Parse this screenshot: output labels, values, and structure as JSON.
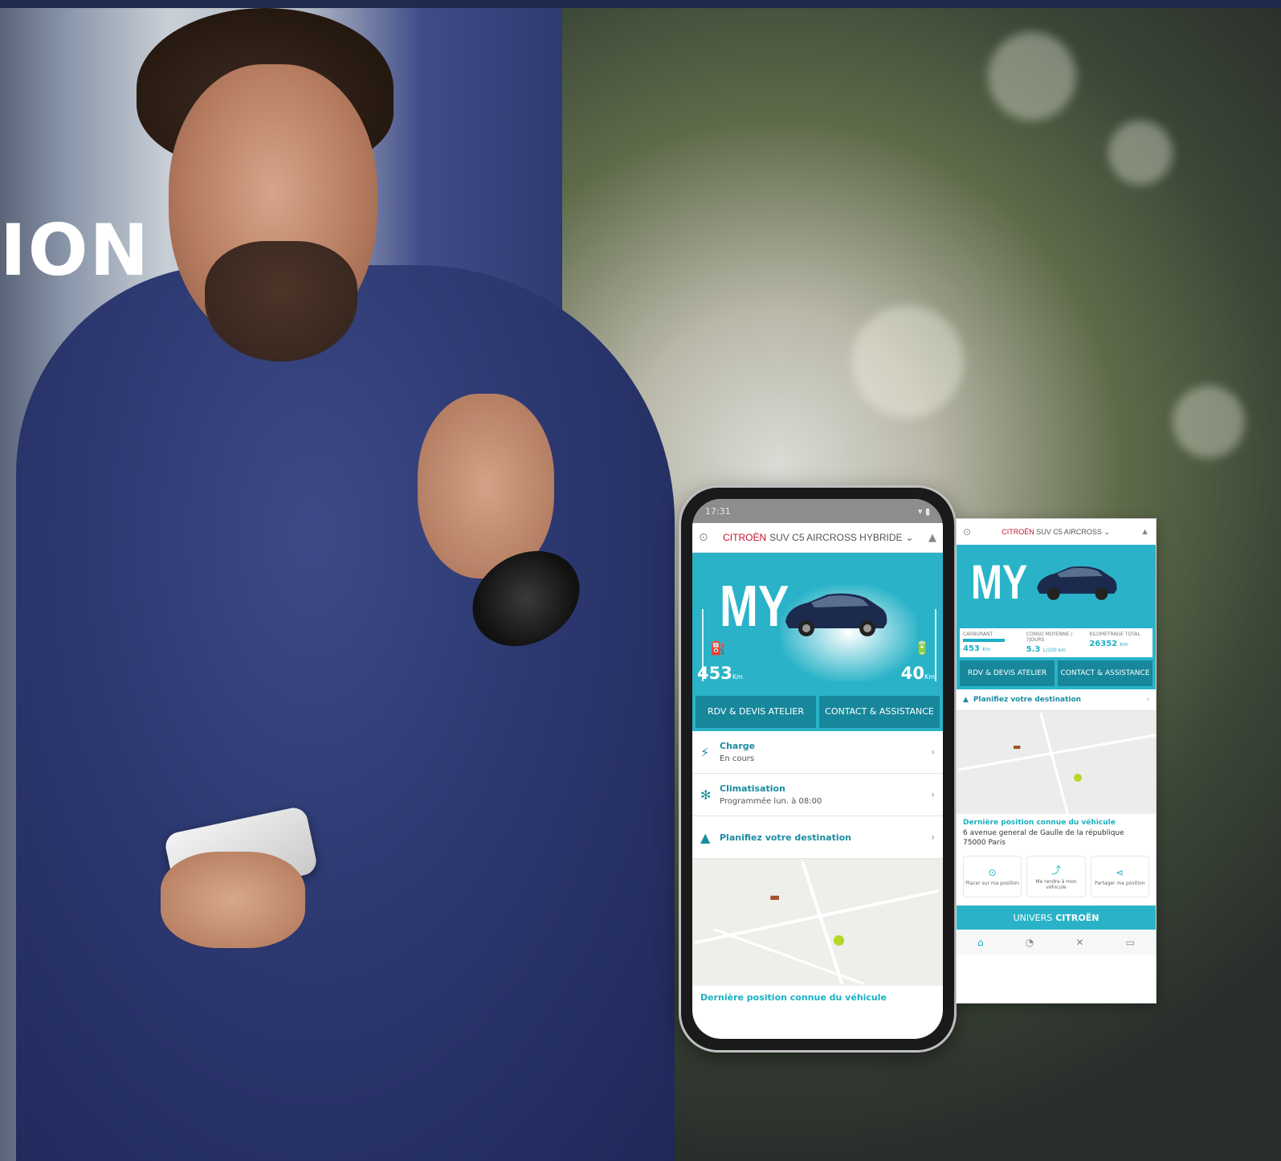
{
  "hero": {
    "headline": "ION"
  },
  "phone": {
    "status_time": "17:31",
    "brand": "CITROËN",
    "model": "SUV C5 AIRCROSS HYBRIDE",
    "hero_logo": "MY",
    "fuel_range": "453",
    "electric_range": "40",
    "range_unit": "Km",
    "actions": [
      "RDV & DEVIS ATELIER",
      "CONTACT & ASSISTANCE"
    ],
    "rows": [
      {
        "title": "Charge",
        "subtitle": "En cours",
        "icon": "charging-icon"
      },
      {
        "title": "Climatisation",
        "subtitle": "Programmée lun. à 08:00",
        "icon": "fan-icon"
      },
      {
        "title": "Planifiez votre destination",
        "subtitle": "",
        "icon": "navigation-arrow-icon"
      }
    ],
    "last_position_label": "Dernière position connue du véhicule"
  },
  "screen2": {
    "brand": "CITROËN",
    "model": "SUV C5 AIRCROSS",
    "hero_logo": "MY",
    "stats": {
      "fuel_label": "CARBURANT",
      "fuel_value": "453",
      "fuel_unit": "Km",
      "consumption_label": "CONSO MOYENNE / 7JOURS",
      "consumption_value": "5.3",
      "consumption_unit": "L/100 km",
      "mileage_label": "KILOMETRAGE TOTAL",
      "mileage_value": "26352",
      "mileage_unit": "Km"
    },
    "actions": [
      "RDV & DEVIS ATELIER",
      "CONTACT & ASSISTANCE"
    ],
    "destination_label": "Planifiez votre destination",
    "last_position_label": "Dernière position connue du véhicule",
    "address_line1": "6 avenue general de Gaulle de la république",
    "address_line2": "75000 Paris",
    "quick_actions": [
      "Placer sur ma position",
      "Me rendre à mon véhicule",
      "Partager ma position"
    ],
    "univers_label": "UNIVERS",
    "univers_brand": "CITROËN",
    "tabs": [
      "home-icon",
      "dashboard-icon",
      "tools-icon",
      "car-icon"
    ]
  },
  "colors": {
    "accent_teal": "#2ab3c8",
    "dark_teal": "#17879b",
    "brand_red": "#c4122f",
    "map_dot": "#b6d628"
  }
}
